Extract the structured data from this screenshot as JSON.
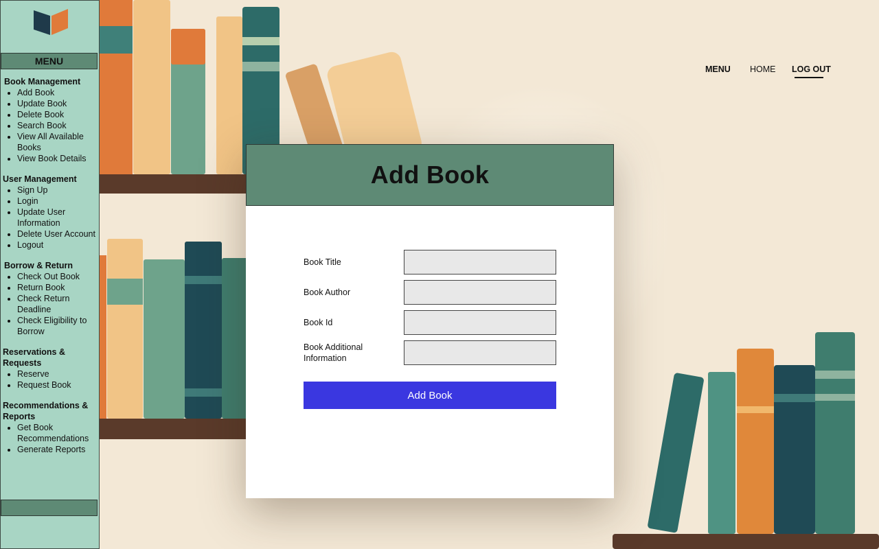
{
  "sidebar": {
    "logo_icon": "open-book-icon",
    "menu_label": "MENU",
    "sections": [
      {
        "title": "Book Management",
        "items": [
          "Add Book",
          "Update Book",
          "Delete Book",
          "Search Book",
          "View All Available Books",
          "View Book Details"
        ]
      },
      {
        "title": "User Management",
        "items": [
          "Sign Up",
          "Login",
          "Update User Information",
          "Delete User Account",
          "Logout"
        ]
      },
      {
        "title": "Borrow & Return",
        "items": [
          "Check Out Book",
          "Return Book",
          "Check Return Deadline",
          "Check Eligibility to Borrow"
        ]
      },
      {
        "title": "Reservations & Requests",
        "items": [
          "Reserve",
          "Request Book"
        ]
      },
      {
        "title": "Recommendations & Reports",
        "items": [
          "Get Book Recommendations",
          "Generate Reports"
        ]
      }
    ]
  },
  "topnav": {
    "menu": "MENU",
    "home": "HOME",
    "logout": "LOG OUT"
  },
  "modal": {
    "title": "Add Book",
    "fields": [
      {
        "label": "Book Title",
        "value": ""
      },
      {
        "label": "Book Author",
        "value": ""
      },
      {
        "label": "Book Id",
        "value": ""
      },
      {
        "label": "Book Additional Information",
        "value": ""
      }
    ],
    "submit_label": "Add Book"
  },
  "colors": {
    "sidebar_bg": "#a8d5c4",
    "header_green": "#5e8a75",
    "button_blue": "#3a37e0",
    "page_bg": "#f3e8d6"
  }
}
